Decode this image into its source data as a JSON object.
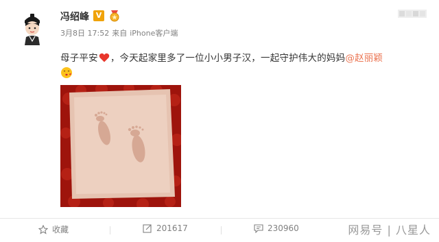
{
  "post": {
    "author": "冯绍峰",
    "verified_badge": "V",
    "date": "3月8日 17:52",
    "source_prefix": "来自",
    "source": "iPhone客户端",
    "text_part1": "母子平安",
    "text_part2": "，今天起家里多了一位小小男子汉，一起守护伟大的妈妈",
    "mention": "@赵丽颖",
    "mention_color": "#eb7350"
  },
  "actions": {
    "favorite_label": "收藏",
    "repost_count": "201617",
    "comment_count": "230960"
  },
  "watermark": {
    "text": "网易号 | 八星人"
  },
  "icons": {
    "avatar": "cartoon-avatar-icon",
    "medal": "medal-emoji-icon",
    "heart": "red-heart-icon",
    "face": "kiss-face-emoji-icon",
    "favorite": "star-icon",
    "repost": "repost-icon",
    "comment": "comment-icon"
  },
  "colors": {
    "photo_background": "#a3150e",
    "text_secondary": "#808080"
  }
}
